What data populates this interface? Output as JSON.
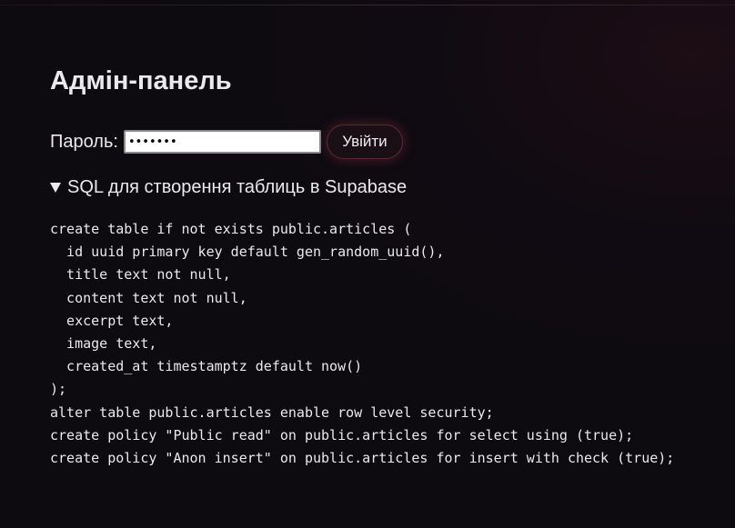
{
  "page": {
    "title": "Адмін-панель"
  },
  "login": {
    "password_label": "Пароль:",
    "password_value": "•••••••",
    "submit_label": "Увійти"
  },
  "sql_section": {
    "summary": "SQL для створення таблиць в Supabase",
    "expanded": true,
    "code": "create table if not exists public.articles (\n  id uuid primary key default gen_random_uuid(),\n  title text not null,\n  content text not null,\n  excerpt text,\n  image text,\n  created_at timestamptz default now()\n);\nalter table public.articles enable row level security;\ncreate policy \"Public read\" on public.articles for select using (true);\ncreate policy \"Anon insert\" on public.articles for insert with check (true);"
  },
  "colors": {
    "background": "#0e0b10",
    "text": "#ece9ee",
    "button_glow": "#d23c50"
  },
  "icons": {
    "disclosure": "triangle-down-icon"
  }
}
